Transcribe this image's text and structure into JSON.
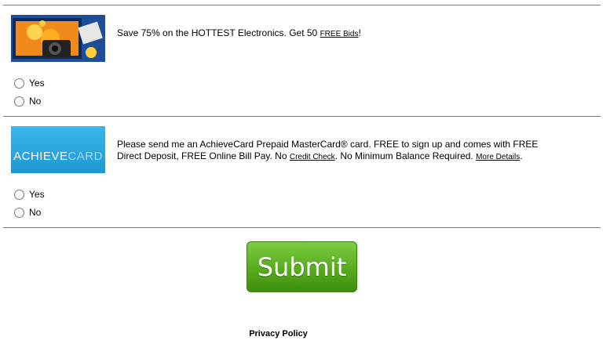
{
  "offers": [
    {
      "text": "Save 75% on the HOTTEST Electronics. Get 50 ",
      "link": "FREE Bids",
      "suffix": "!",
      "yes_label": "Yes",
      "no_label": "No"
    },
    {
      "text_1": "Please send me an AchieveCard Prepaid MasterCard® card. FREE to sign up and comes with FREE Direct Deposit, FREE Online Bill Pay. No ",
      "link_1": "Credit Check",
      "text_2": ". No Minimum Balance Required. ",
      "link_2": "More Details",
      "suffix": ".",
      "logo_text_a": "ACHIEVE",
      "logo_text_b": "CARD",
      "yes_label": "Yes",
      "no_label": "No"
    }
  ],
  "submit_label": "Submit",
  "privacy_label": "Privacy Policy",
  "colors": {
    "divider": "#7a7a7a",
    "submit_green": "#5aae1f",
    "achieve_blue": "#2ea9df"
  }
}
